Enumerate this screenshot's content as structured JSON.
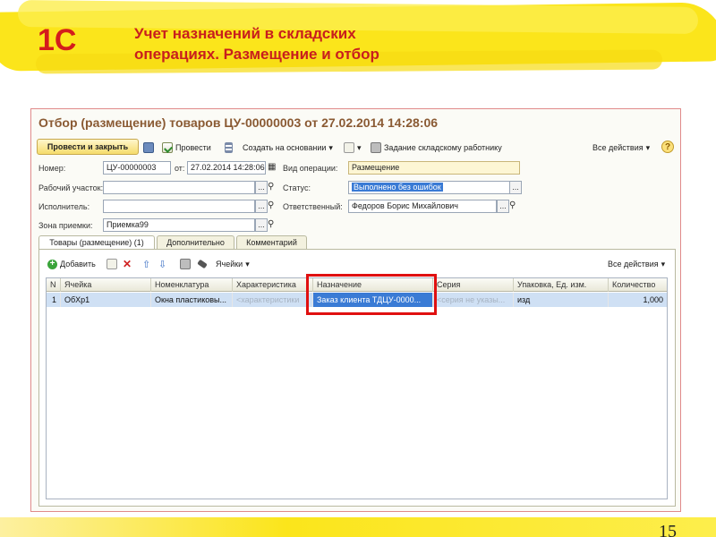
{
  "slide": {
    "title_line1": "Учет назначений в складских",
    "title_line2": "операциях. Размещение и отбор",
    "page_number": "15",
    "logo_text": "1С"
  },
  "document": {
    "title": "Отбор (размещение) товаров ЦУ-00000003 от 27.02.2014 14:28:06"
  },
  "toolbar": {
    "post_close": "Провести и закрыть",
    "post": "Провести",
    "create_based": "Создать на основании",
    "task_worker": "Задание складскому работнику",
    "all_actions": "Все действия",
    "help": "?"
  },
  "form": {
    "number_label": "Номер:",
    "number_value": "ЦУ-00000003",
    "date_label": "от:",
    "date_value": "27.02.2014 14:28:06",
    "op_type_label": "Вид операции:",
    "op_type_value": "Размещение",
    "work_area_label": "Рабочий участок:",
    "work_area_value": "",
    "status_label": "Статус:",
    "status_value": "Выполнено без ошибок",
    "executor_label": "Исполнитель:",
    "executor_value": "",
    "responsible_label": "Ответственный:",
    "responsible_value": "Федоров Борис Михайлович",
    "zone_label": "Зона приемки:",
    "zone_value": "Приемка99"
  },
  "tabs": [
    {
      "label": "Товары (размещение) (1)"
    },
    {
      "label": "Дополнительно"
    },
    {
      "label": "Комментарий"
    }
  ],
  "table_toolbar": {
    "add": "Добавить",
    "cells": "Ячейки",
    "all_actions": "Все действия"
  },
  "table": {
    "columns": [
      "N",
      "Ячейка",
      "Номенклатура",
      "Характеристика",
      "Назначение",
      "Серия",
      "Упаковка, Ед. изм.",
      "Количество"
    ],
    "rows": [
      {
        "n": "1",
        "cell": "ОбХр1",
        "item": "Окна пластиковы...",
        "characteristic": "<характеристики",
        "purpose": "Заказ клиента ТДЦУ-0000...",
        "series": "<серия не указы...",
        "package": "изд",
        "quantity": "1,000"
      }
    ]
  },
  "colors": {
    "accent_red": "#c81e1e",
    "highlight_yellow": "#fbe51b",
    "selection_blue": "#3a7bd5"
  }
}
